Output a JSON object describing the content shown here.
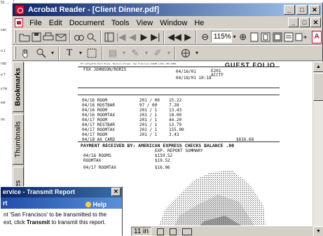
{
  "background_window": {
    "lines": [
      "52 ....",
      "can",
      "n 1",
      "cop",
      "e T",
      "y he",
      "ext",
      "on."
    ]
  },
  "window": {
    "title": "Acrobat Reader - [Client Dinner.pdf]",
    "controls": {
      "minimize": "_",
      "maximize": "□",
      "close": "✕"
    }
  },
  "menu": {
    "items": [
      "File",
      "Edit",
      "Document",
      "Tools",
      "View",
      "Window",
      "He"
    ]
  },
  "toolbar": {
    "zoom_value": "115%"
  },
  "nav_tabs": [
    "Bookmarks",
    "Thumbnails",
    "natures"
  ],
  "statusbar": {
    "page_size": "11 in"
  },
  "document": {
    "header_small": "777 Lafayette Park Place, Mission Street, San Francisco 94108 (415) 555-0000",
    "folio_title": "GUEST FOLIO",
    "guest": "FOX JOHNSON/RORIS",
    "arrival": "04/16/01",
    "room": "E201",
    "depart": "04/18/01 10:18",
    "rate": "ACCTF",
    "rows": [
      {
        "date": "04/16",
        "desc": "ROOM",
        "ref": "201 / 00",
        "amt": "15.22"
      },
      {
        "date": "04/16",
        "desc": "ROSTBAR",
        "ref": "97 / 00",
        "amt": "7.28"
      },
      {
        "date": "04/16",
        "desc": "ROOM",
        "ref": "201 / 1",
        "amt": "13.43"
      },
      {
        "date": "04/16",
        "desc": "ROOMTAX",
        "ref": "201 / 1",
        "amt": "18.00"
      },
      {
        "date": "04/17",
        "desc": "ROOM",
        "ref": "201 / 1",
        "amt": "44.20"
      },
      {
        "date": "04/17",
        "desc": "RESTBAR",
        "ref": "201 / 1",
        "amt": "13.79"
      },
      {
        "date": "04/17",
        "desc": "ROOMTAX",
        "ref": "201 / 1",
        "amt": "155.00"
      },
      {
        "date": "04/17",
        "desc": "ROOM",
        "ref": "201 / 1",
        "amt": "3.43"
      },
      {
        "date": "04/18",
        "desc": "AX CARD",
        "ref": "",
        "amt": ""
      }
    ],
    "subtotal": "$816.68",
    "payment_line": "PAYMENT RECEIVED BY: AMERICAN EXPRESS   CHECKS BALANCE  .00",
    "report_line": "EXP. REPORT SUMMARY",
    "summary_rows": [
      {
        "date": "04/16",
        "desc": "ROOMS",
        "amt": "$159.52"
      },
      {
        "date": "",
        "desc": "ROOMTAX",
        "amt": "$19.52"
      },
      {
        "date": "04/17",
        "desc": "ROOMTAX",
        "amt": "$16.96"
      }
    ]
  },
  "dialog": {
    "title": "ervice - Transmit Report",
    "header": "rt",
    "help_label": "Help",
    "body_line1": "nt 'San Francisco' to be transmitted to the",
    "body_line2_pre": "ext, click ",
    "body_line2_bold": "Transmit",
    "body_line2_post": " to transmit this report."
  }
}
